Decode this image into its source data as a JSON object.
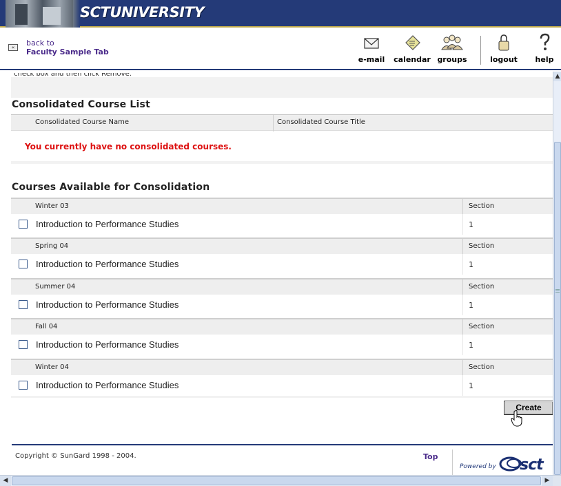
{
  "banner": {
    "logo_text": "SCTUNIVERSITY"
  },
  "nav": {
    "back_to": "back to",
    "back_tab": "Faculty Sample Tab",
    "back_icon": "«",
    "tools": [
      {
        "label": "e-mail",
        "icon": "envelope-icon"
      },
      {
        "label": "calendar",
        "icon": "calendar-icon"
      },
      {
        "label": "groups",
        "icon": "groups-icon"
      },
      {
        "label": "logout",
        "icon": "lock-icon"
      },
      {
        "label": "help",
        "icon": "question-icon"
      }
    ]
  },
  "content": {
    "clipped_instruction": "check box and then click Remove.",
    "consolidated": {
      "title": "Consolidated Course List",
      "col_name": "Consolidated Course Name",
      "col_title": "Consolidated Course Title",
      "empty_message": "You currently have no consolidated courses."
    },
    "available": {
      "title": "Courses Available for Consolidation",
      "section_header": "Section",
      "terms": [
        {
          "term": "Winter 03",
          "course": "Introduction to Performance Studies",
          "section": "1",
          "checked": false
        },
        {
          "term": "Spring 04",
          "course": "Introduction to Performance Studies",
          "section": "1",
          "checked": false
        },
        {
          "term": "Summer 04",
          "course": "Introduction to Performance Studies",
          "section": "1",
          "checked": false
        },
        {
          "term": "Fall 04",
          "course": "Introduction to Performance Studies",
          "section": "1",
          "checked": false
        },
        {
          "term": "Winter 04",
          "course": "Introduction to Performance Studies",
          "section": "1",
          "checked": false
        }
      ]
    },
    "create_label": "Create"
  },
  "footer": {
    "copyright": "Copyright © SunGard 1998 - 2004.",
    "top_link": "Top",
    "powered_by": "Powered by",
    "brand": "sct"
  },
  "colors": {
    "banner": "#243a78",
    "accent_gold": "#bfa94a",
    "link_purple": "#4a2a8a",
    "error_red": "#dd1111"
  }
}
